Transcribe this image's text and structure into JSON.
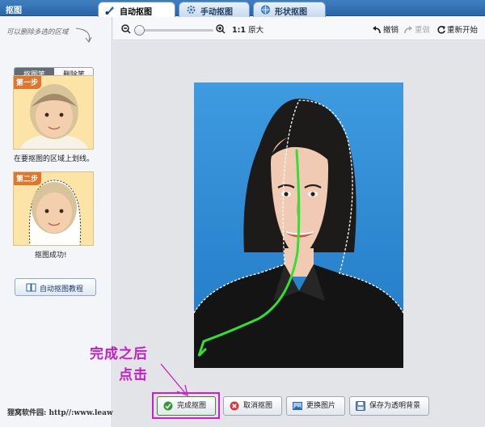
{
  "app": {
    "title": "抠图"
  },
  "tabs": [
    {
      "label": "自动抠图",
      "icon": "brush-icon",
      "active": true
    },
    {
      "label": "手动抠图",
      "icon": "gear-icon",
      "active": false
    },
    {
      "label": "形状抠图",
      "icon": "globe-icon",
      "active": false
    }
  ],
  "sidebar": {
    "hint": "可以删除多选的区域",
    "pen_label": "抠图笔",
    "eraser_label": "删除笔",
    "step1": {
      "badge": "第一步",
      "caption": "在要抠图的区域上划线。"
    },
    "step2": {
      "badge": "第二步",
      "caption": "抠图成功!"
    },
    "tutorial_label": "自动抠图教程",
    "watermark": "狸窝软件园: http//:www.leawo.cn"
  },
  "toolbar": {
    "zoom_level": 0,
    "ratio_label": "1:1",
    "original_size_label": "原大",
    "undo_label": "撤销",
    "redo_label": "重做",
    "restart_label": "重新开始"
  },
  "buttons": {
    "done": "完成抠图",
    "cancel": "取消抠图",
    "change": "更换图片",
    "save": "保存为透明背景"
  },
  "annotation": {
    "line1": "完成之后",
    "line2": "点击"
  },
  "colors": {
    "accent": "#2a66a8",
    "annotation": "#c41ec4",
    "stroke": "#32e032",
    "photo_bg": "#2d8fd8"
  }
}
